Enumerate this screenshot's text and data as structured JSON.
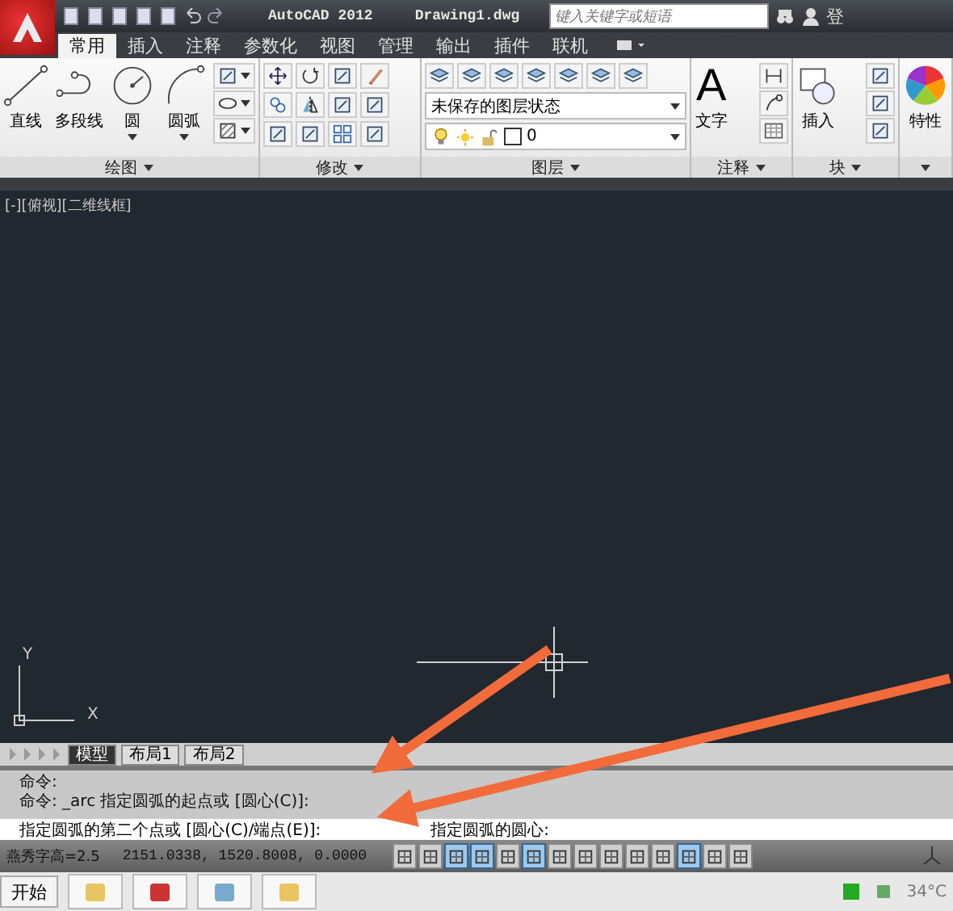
{
  "title_bar": {
    "app_title": "AutoCAD 2012",
    "file_name": "Drawing1.dwg",
    "search": {
      "placeholder": "键入关键字或短语"
    },
    "cut_label": "登"
  },
  "tabs": [
    {
      "label": "常用",
      "selected": true
    },
    {
      "label": "插入",
      "selected": false
    },
    {
      "label": "注释",
      "selected": false
    },
    {
      "label": "参数化",
      "selected": false
    },
    {
      "label": "视图",
      "selected": false
    },
    {
      "label": "管理",
      "selected": false
    },
    {
      "label": "输出",
      "selected": false
    },
    {
      "label": "插件",
      "selected": false
    },
    {
      "label": "联机",
      "selected": false
    }
  ],
  "panels": [
    {
      "kind": "draw",
      "title": "绘图",
      "tools": [
        {
          "label": "直线",
          "dropdown": false
        },
        {
          "label": "多段线",
          "dropdown": false
        },
        {
          "label": "圆",
          "dropdown": true
        },
        {
          "label": "圆弧",
          "dropdown": true
        }
      ]
    },
    {
      "kind": "modify",
      "title": "修改"
    },
    {
      "kind": "layers",
      "title": "图层",
      "layer_state": "未保存的图层状态",
      "current_layer": "0"
    },
    {
      "kind": "annotate",
      "title": "注释",
      "big_glyph": "A",
      "tool": "文字"
    },
    {
      "kind": "block",
      "title": "块",
      "tool": "插入"
    },
    {
      "kind": "properties",
      "tool": "特性"
    }
  ],
  "viewport": {
    "label": "[-][俯视][二维线框]",
    "axis_y": "Y",
    "axis_x": "X"
  },
  "layout_tabs": [
    {
      "label": "模型",
      "selected": true
    },
    {
      "label": "布局1",
      "selected": false
    },
    {
      "label": "布局2",
      "selected": false
    }
  ],
  "command_line": {
    "history": [
      "命令:",
      "命令: _arc 指定圆弧的起点或 [圆心(C)]:"
    ],
    "prompt": "指定圆弧的第二个点或 [圆心(C)/端点(E)]:",
    "next_prompt": "指定圆弧的圆心:"
  },
  "status_bar": {
    "text_height": "燕秀字高=2.5",
    "coordinates": "2151.0338, 1520.8008, 0.0000",
    "toggles": [
      {
        "on": false
      },
      {
        "on": false
      },
      {
        "on": true
      },
      {
        "on": true
      },
      {
        "on": false
      },
      {
        "on": true
      },
      {
        "on": false
      },
      {
        "on": false
      },
      {
        "on": false
      },
      {
        "on": false
      },
      {
        "on": false
      },
      {
        "on": true
      },
      {
        "on": false
      },
      {
        "on": false
      }
    ]
  },
  "taskbar": {
    "start": "开始",
    "temperature": "34°C"
  }
}
